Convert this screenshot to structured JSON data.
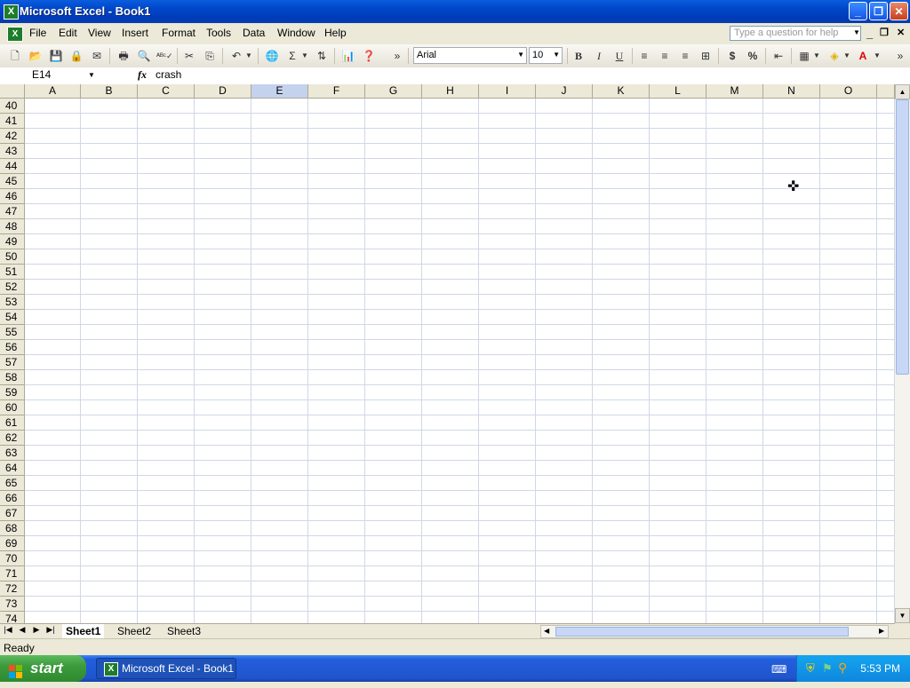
{
  "window": {
    "title": "Microsoft Excel - Book1",
    "minimize": "_",
    "restore": "❐",
    "close": "✕"
  },
  "menu": {
    "items": [
      "File",
      "Edit",
      "View",
      "Insert",
      "Format",
      "Tools",
      "Data",
      "Window",
      "Help"
    ],
    "help_placeholder": "Type a question for help",
    "doc_min": "_",
    "doc_restore": "❐",
    "doc_close": "✕"
  },
  "toolbar": {
    "font_name": "Arial",
    "font_size": "10",
    "bold": "B",
    "italic": "I",
    "underline": "U",
    "currency": "$",
    "percent": "%"
  },
  "formula_bar": {
    "name_box": "E14",
    "fx": "fx",
    "content": "crash"
  },
  "grid": {
    "columns": [
      "A",
      "B",
      "C",
      "D",
      "E",
      "F",
      "G",
      "H",
      "I",
      "J",
      "K",
      "L",
      "M",
      "N",
      "O"
    ],
    "selected_column": "E",
    "rows": [
      "40",
      "41",
      "42",
      "43",
      "44",
      "45",
      "46",
      "47",
      "48",
      "49",
      "50",
      "51",
      "52",
      "53",
      "54",
      "55",
      "56",
      "57",
      "58",
      "59",
      "60",
      "61",
      "62",
      "63",
      "64",
      "65",
      "66",
      "67",
      "68",
      "69",
      "70",
      "71",
      "72",
      "73",
      "74"
    ]
  },
  "sheets": {
    "tabs": [
      "Sheet1",
      "Sheet2",
      "Sheet3"
    ],
    "active": "Sheet1"
  },
  "status": {
    "text": "Ready"
  },
  "taskbar": {
    "start_label": "start",
    "task_item": "Microsoft Excel - Book1",
    "clock": "5:53 PM"
  }
}
